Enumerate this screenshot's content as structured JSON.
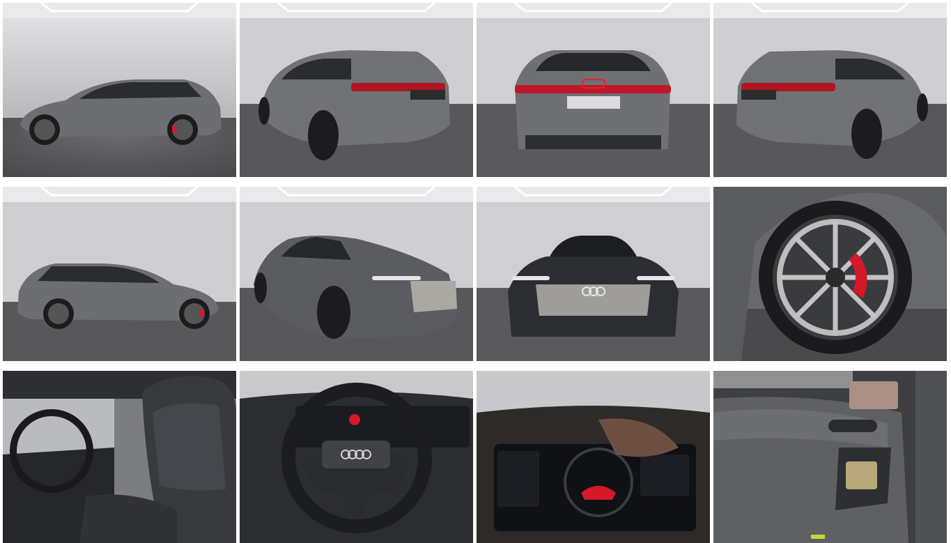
{
  "gallery": {
    "photos": [
      {
        "view": "side-left",
        "kind": "car-side"
      },
      {
        "view": "rear-three-quarter-left",
        "kind": "car-rear34"
      },
      {
        "view": "rear",
        "kind": "car-rear"
      },
      {
        "view": "rear-three-quarter-right",
        "kind": "car-rear34-right"
      },
      {
        "view": "side-right",
        "kind": "car-side-right"
      },
      {
        "view": "front-three-quarter",
        "kind": "car-front34"
      },
      {
        "view": "front",
        "kind": "car-front"
      },
      {
        "view": "wheel-detail",
        "kind": "wheel"
      },
      {
        "view": "interior-seats",
        "kind": "seats"
      },
      {
        "view": "steering-wheel",
        "kind": "steering"
      },
      {
        "view": "instrument-cluster",
        "kind": "cluster"
      },
      {
        "view": "door-panel",
        "kind": "door"
      }
    ],
    "colors": {
      "studio_wall": "#d2d2d4",
      "studio_floor": "#5a5a5c",
      "car_body": "#6e7073",
      "accent_red": "#d3192a",
      "interior": "#2b2d31"
    }
  }
}
